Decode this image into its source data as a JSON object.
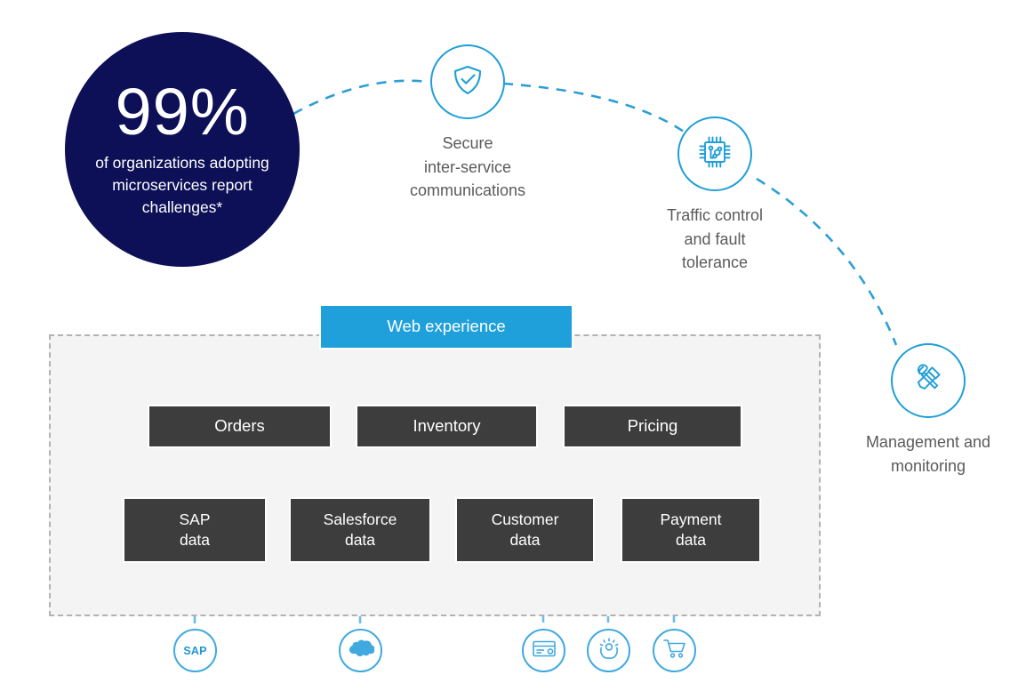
{
  "stat": {
    "value": "99%",
    "caption": "of organizations\nadopting microservices\nreport challenges*"
  },
  "colors": {
    "navy": "#0d1056",
    "blue": "#1fa0da",
    "icon_blue": "#3fa9e0",
    "dark_box": "#3d3d3d",
    "panel_bg": "#f4f4f4",
    "panel_border": "#b2b2b2",
    "label_gray": "#5b5b5b"
  },
  "features": [
    {
      "id": "secure",
      "icon": "shield-check-icon",
      "label": "Secure\ninter-service\ncommunications"
    },
    {
      "id": "traffic",
      "icon": "microchip-icon",
      "label": "Traffic control\nand fault\ntolerance"
    },
    {
      "id": "mgmt",
      "icon": "tools-icon",
      "label": "Management and\nmonitoring"
    }
  ],
  "architecture": {
    "web": {
      "label": "Web experience"
    },
    "services": [
      {
        "label": "Orders"
      },
      {
        "label": "Inventory"
      },
      {
        "label": "Pricing"
      }
    ],
    "data_stores": [
      {
        "label": "SAP\ndata"
      },
      {
        "label": "Salesforce\ndata"
      },
      {
        "label": "Customer\ndata"
      },
      {
        "label": "Payment\ndata"
      }
    ]
  },
  "systems": [
    {
      "id": "sap",
      "icon": "sap-logo-icon",
      "label": "SAP"
    },
    {
      "id": "salesforce",
      "icon": "salesforce-cloud-icon",
      "label": ""
    },
    {
      "id": "payment",
      "icon": "credit-card-icon",
      "label": ""
    },
    {
      "id": "customer",
      "icon": "customer-care-icon",
      "label": ""
    },
    {
      "id": "commerce",
      "icon": "shopping-cart-icon",
      "label": ""
    }
  ]
}
